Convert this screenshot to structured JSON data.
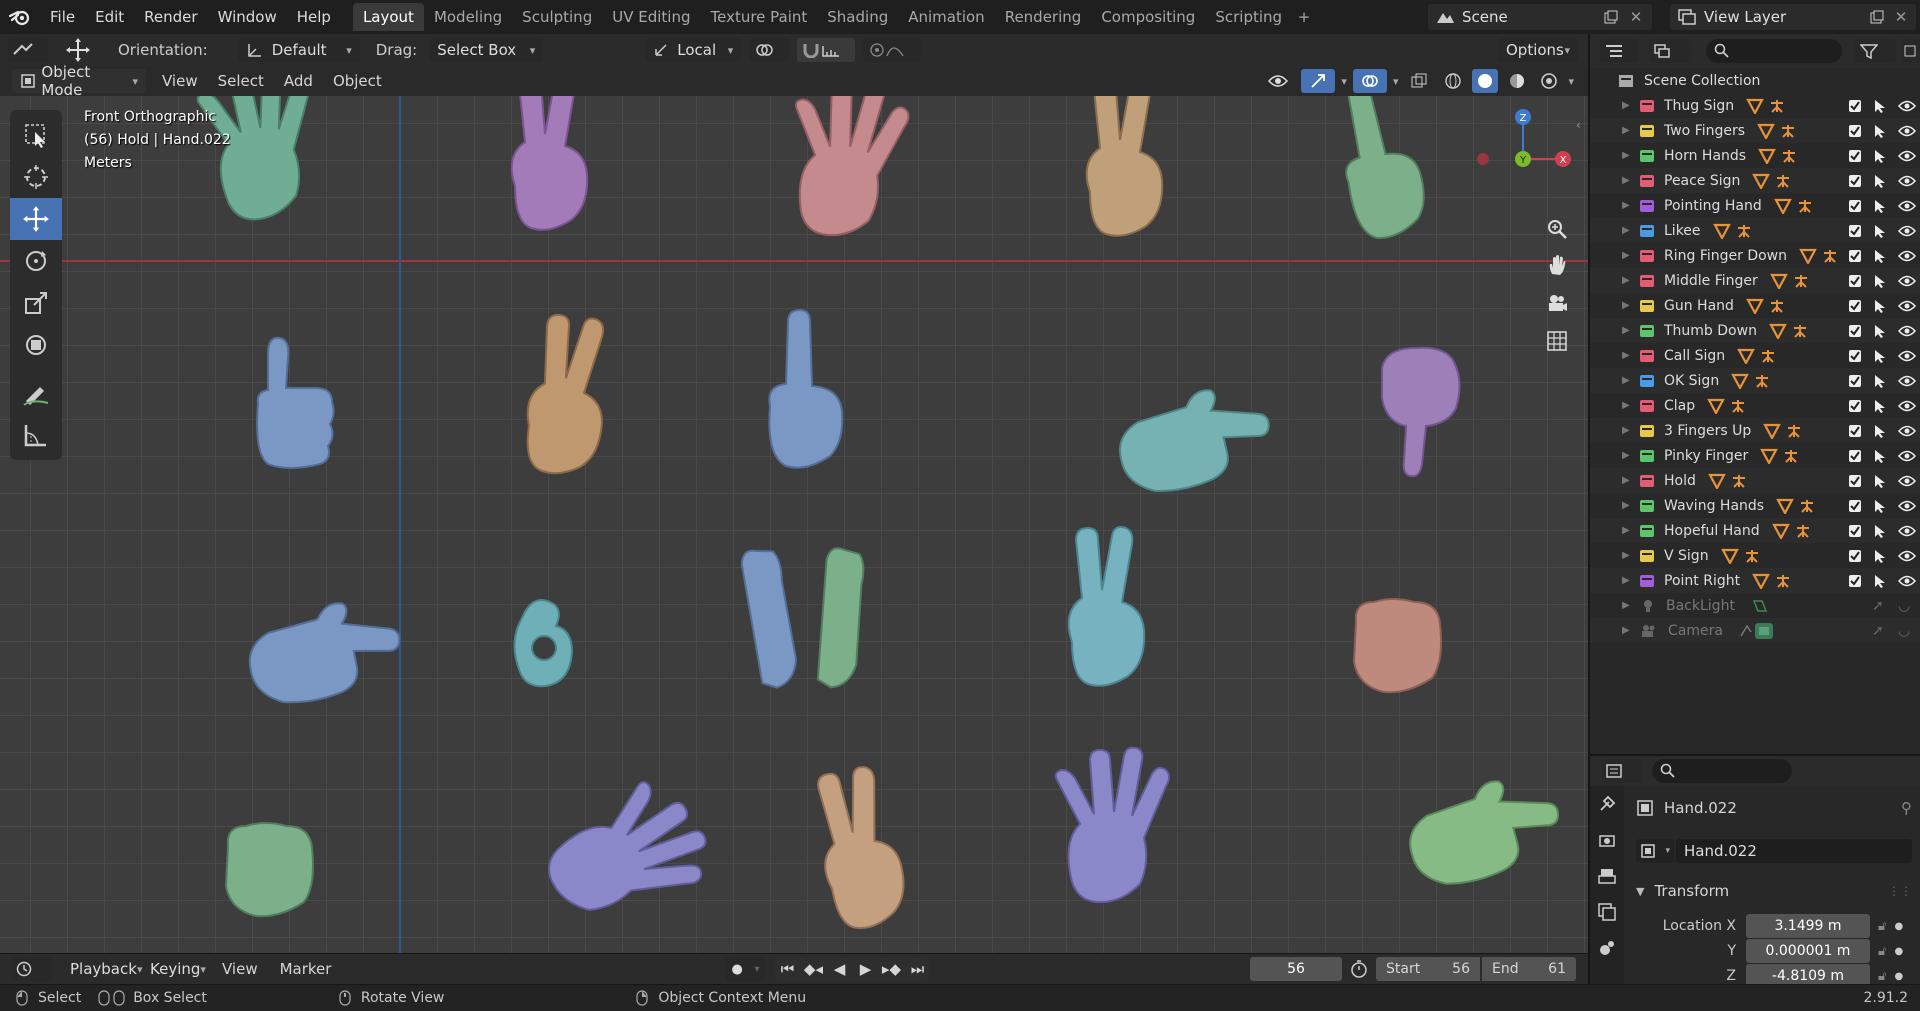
{
  "topbar": {
    "menus": [
      "File",
      "Edit",
      "Render",
      "Window",
      "Help"
    ],
    "workspaces": [
      "Layout",
      "Modeling",
      "Sculpting",
      "UV Editing",
      "Texture Paint",
      "Shading",
      "Animation",
      "Rendering",
      "Compositing",
      "Scripting"
    ],
    "active_workspace": "Layout",
    "scene_label": "Scene",
    "view_layer_label": "View Layer"
  },
  "tool_header": {
    "orientation_label": "Orientation:",
    "orientation_value": "Default",
    "drag_label": "Drag:",
    "drag_value": "Select Box",
    "transform_space": "Local",
    "options_label": "Options"
  },
  "view_header": {
    "mode": "Object Mode",
    "menus": [
      "View",
      "Select",
      "Add",
      "Object"
    ]
  },
  "viewport": {
    "view_name": "Front Orthographic",
    "frame_info": "(56) Hold | Hand.022",
    "units": "Meters",
    "gizmo": {
      "z": "Z",
      "y": "Y",
      "x": "X"
    }
  },
  "toolbar": {
    "tools": [
      "select-box-icon",
      "cursor-icon",
      "move-icon",
      "rotate-icon",
      "scale-icon",
      "transform-icon",
      "annotate-icon",
      "measure-icon"
    ],
    "active": "move-icon"
  },
  "outliner": {
    "root": "Scene Collection",
    "collections": [
      {
        "name": "Thug Sign",
        "color": "#e25c74"
      },
      {
        "name": "Two Fingers",
        "color": "#e6c84a"
      },
      {
        "name": "Horn Hands",
        "color": "#5cc46a"
      },
      {
        "name": "Peace Sign",
        "color": "#e25c74"
      },
      {
        "name": "Pointing Hand",
        "color": "#a25ed6"
      },
      {
        "name": "Likee",
        "color": "#4a9be6"
      },
      {
        "name": "Ring Finger Down",
        "color": "#e25c74"
      },
      {
        "name": "Middle Finger",
        "color": "#e25c74"
      },
      {
        "name": "Gun Hand",
        "color": "#e6c84a"
      },
      {
        "name": "Thumb Down",
        "color": "#5cc46a"
      },
      {
        "name": "Call Sign",
        "color": "#e25c74"
      },
      {
        "name": "OK Sign",
        "color": "#4a9be6"
      },
      {
        "name": "Clap",
        "color": "#e25c74"
      },
      {
        "name": "3 Fingers Up",
        "color": "#e6c84a"
      },
      {
        "name": "Pinky Finger",
        "color": "#5cc46a"
      },
      {
        "name": "Hold",
        "color": "#e25c74"
      },
      {
        "name": "Waving Hands",
        "color": "#5cc46a"
      },
      {
        "name": "Hopeful Hand",
        "color": "#5cc46a"
      },
      {
        "name": "V Sign",
        "color": "#e6c84a"
      },
      {
        "name": "Point Right",
        "color": "#a25ed6"
      }
    ],
    "objects": [
      "BackLight",
      "Camera"
    ]
  },
  "properties": {
    "object_name": "Hand.022",
    "data_name": "Hand.022",
    "panel_title": "Transform",
    "location_label": "Location X",
    "y_label": "Y",
    "z_label": "Z",
    "location_x": "3.1499 m",
    "location_y": "0.000001 m",
    "location_z": "-4.8109 m"
  },
  "timeline": {
    "menus": [
      "Playback",
      "Keying",
      "View",
      "Marker"
    ],
    "current_frame": "56",
    "start_label": "Start",
    "start_value": "56",
    "end_label": "End",
    "end_value": "61"
  },
  "statusbar": {
    "select": "Select",
    "box_select": "Box Select",
    "rotate_view": "Rotate View",
    "context_menu": "Object Context Menu",
    "version": "2.91.2"
  }
}
